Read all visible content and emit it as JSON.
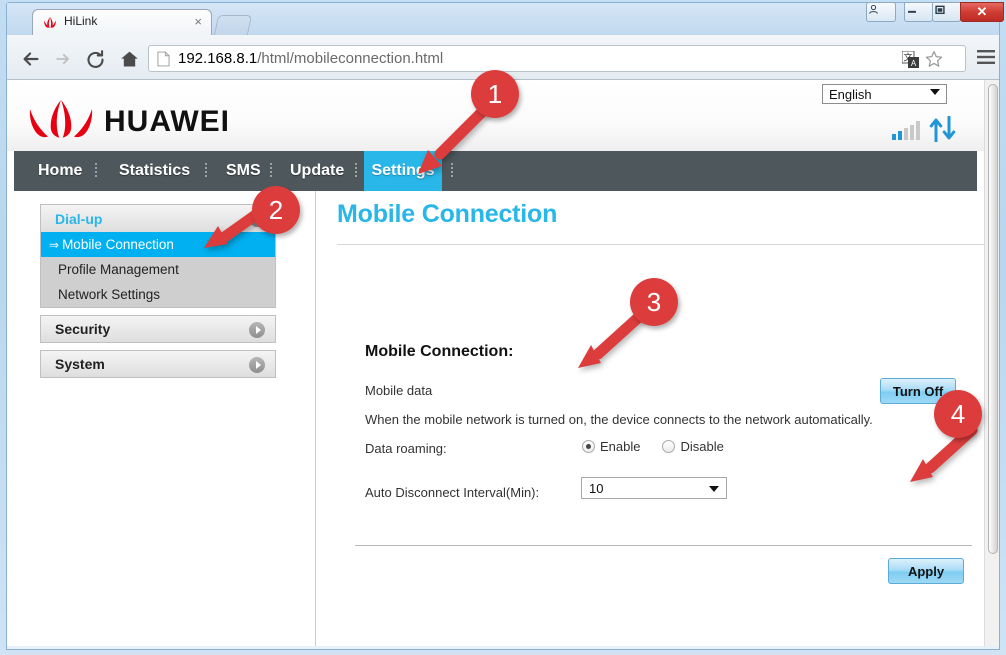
{
  "browser": {
    "tab": {
      "title": "HiLink",
      "favicon": "huawei-favicon",
      "close_label": "×"
    },
    "new_tab_label": "",
    "window_controls": {
      "user": "□",
      "minimize": "–",
      "maximize": "□",
      "close": "✕"
    },
    "toolbar": {
      "back": "←",
      "forward": "→",
      "reload": "↻",
      "home": "⌂",
      "menu": "☰"
    },
    "omnibox": {
      "url_host": "192.168.8.1",
      "url_path": "/html/mobileconnection.html",
      "url_full": "192.168.8.1/html/mobileconnection.html",
      "translate_icon": "translate-icon",
      "bookmark_icon": "star-icon"
    }
  },
  "router": {
    "brand": "HUAWEI",
    "language": {
      "selected": "English"
    },
    "status_icons": {
      "signal": "signal-bars-icon",
      "traffic": "up-down-arrows-icon"
    },
    "nav": [
      {
        "label": "Home",
        "active": false
      },
      {
        "label": "Statistics",
        "active": false
      },
      {
        "label": "SMS",
        "active": false
      },
      {
        "label": "Update",
        "active": false
      },
      {
        "label": "Settings",
        "active": true
      }
    ],
    "sidebar": {
      "groups": [
        {
          "label": "Dial-up",
          "expanded": true,
          "items": [
            {
              "label": "Mobile Connection",
              "active": true
            },
            {
              "label": "Profile Management",
              "active": false
            },
            {
              "label": "Network Settings",
              "active": false
            }
          ]
        },
        {
          "label": "Security",
          "expanded": false,
          "items": []
        },
        {
          "label": "System",
          "expanded": false,
          "items": []
        }
      ]
    },
    "content": {
      "title": "Mobile Connection",
      "section_title": "Mobile Connection:",
      "mobile_data_label": "Mobile data",
      "description": "When the mobile network is turned on, the device connects to the network automatically.",
      "turn_off_label": "Turn Off",
      "data_roaming_label": "Data roaming:",
      "roaming_options": [
        {
          "label": "Enable",
          "selected": true
        },
        {
          "label": "Disable",
          "selected": false
        }
      ],
      "interval_label": "Auto Disconnect Interval(Min):",
      "interval_value": "10",
      "apply_label": "Apply"
    }
  },
  "annotations": [
    {
      "number": "1",
      "target": "settings-tab"
    },
    {
      "number": "2",
      "target": "mobile-connection-sidebar-item"
    },
    {
      "number": "3",
      "target": "data-roaming-enable-radio"
    },
    {
      "number": "4",
      "target": "apply-button"
    }
  ],
  "colors": {
    "accent_blue": "#29b6e8",
    "sidebar_active": "#00b0f0",
    "navbar": "#4e585c",
    "badge_red": "#dd3c3c",
    "huawei_red": "#e60012"
  }
}
